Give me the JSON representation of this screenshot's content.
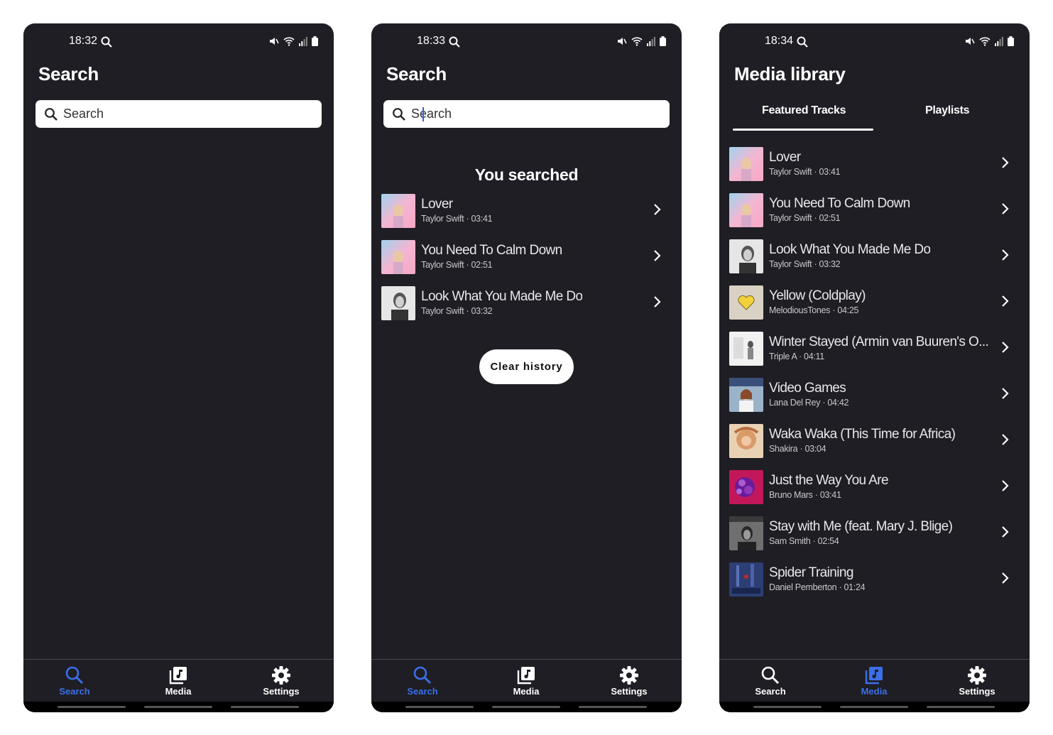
{
  "colors": {
    "background": "#1e1e24",
    "accent_active": "#3b6fe8",
    "text_primary": "#ffffff",
    "search_box": "#ffffff"
  },
  "screens": [
    {
      "status_time": "18:32",
      "title": "Search",
      "search_placeholder": "Search",
      "nav": {
        "search": "Search",
        "media": "Media",
        "settings": "Settings",
        "active": "search"
      }
    },
    {
      "status_time": "18:33",
      "title": "Search",
      "search_placeholder": "Search",
      "section_heading": "You searched",
      "tracks": [
        {
          "title": "Lover",
          "artist": "Taylor Swift",
          "duration": "03:41",
          "art": "pink-cover-icon"
        },
        {
          "title": "You Need To Calm Down",
          "artist": "Taylor Swift",
          "duration": "02:51",
          "art": "pink-cover-icon"
        },
        {
          "title": "Look What You Made Me Do",
          "artist": "Taylor Swift",
          "duration": "03:32",
          "art": "bw-portrait-icon"
        }
      ],
      "clear_history_label": "Clear history",
      "nav": {
        "search": "Search",
        "media": "Media",
        "settings": "Settings",
        "active": "search"
      }
    },
    {
      "status_time": "18:34",
      "title": "Media library",
      "tabs": [
        "Featured Tracks",
        "Playlists"
      ],
      "active_tab": "Featured Tracks",
      "tracks": [
        {
          "title": "Lover",
          "artist": "Taylor Swift",
          "duration": "03:41",
          "art": "pink-cover-icon"
        },
        {
          "title": "You Need To Calm Down",
          "artist": "Taylor Swift",
          "duration": "02:51",
          "art": "pink-cover-icon"
        },
        {
          "title": "Look What You Made Me Do",
          "artist": "Taylor Swift",
          "duration": "03:32",
          "art": "bw-portrait-icon"
        },
        {
          "title": "Yellow (Coldplay)",
          "artist": "MelodiousTones",
          "duration": "04:25",
          "art": "heart-cover-icon"
        },
        {
          "title": "Winter Stayed (Armin van Buuren's O...",
          "artist": "Triple A",
          "duration": "04:11",
          "art": "light-cover-icon"
        },
        {
          "title": "Video Games",
          "artist": "Lana Del Rey",
          "duration": "04:42",
          "art": "lana-cover-icon"
        },
        {
          "title": "Waka Waka (This Time for Africa)",
          "artist": "Shakira",
          "duration": "03:04",
          "art": "shakira-cover-icon"
        },
        {
          "title": "Just the Way You Are",
          "artist": "Bruno Mars",
          "duration": "03:41",
          "art": "flower-cover-icon"
        },
        {
          "title": "Stay with Me (feat. Mary J. Blige)",
          "artist": "Sam Smith",
          "duration": "02:54",
          "art": "grey-portrait-icon"
        },
        {
          "title": "Spider Training",
          "artist": "Daniel Pemberton",
          "duration": "01:24",
          "art": "spider-cover-icon"
        }
      ],
      "nav": {
        "search": "Search",
        "media": "Media",
        "settings": "Settings",
        "active": "media"
      }
    }
  ]
}
